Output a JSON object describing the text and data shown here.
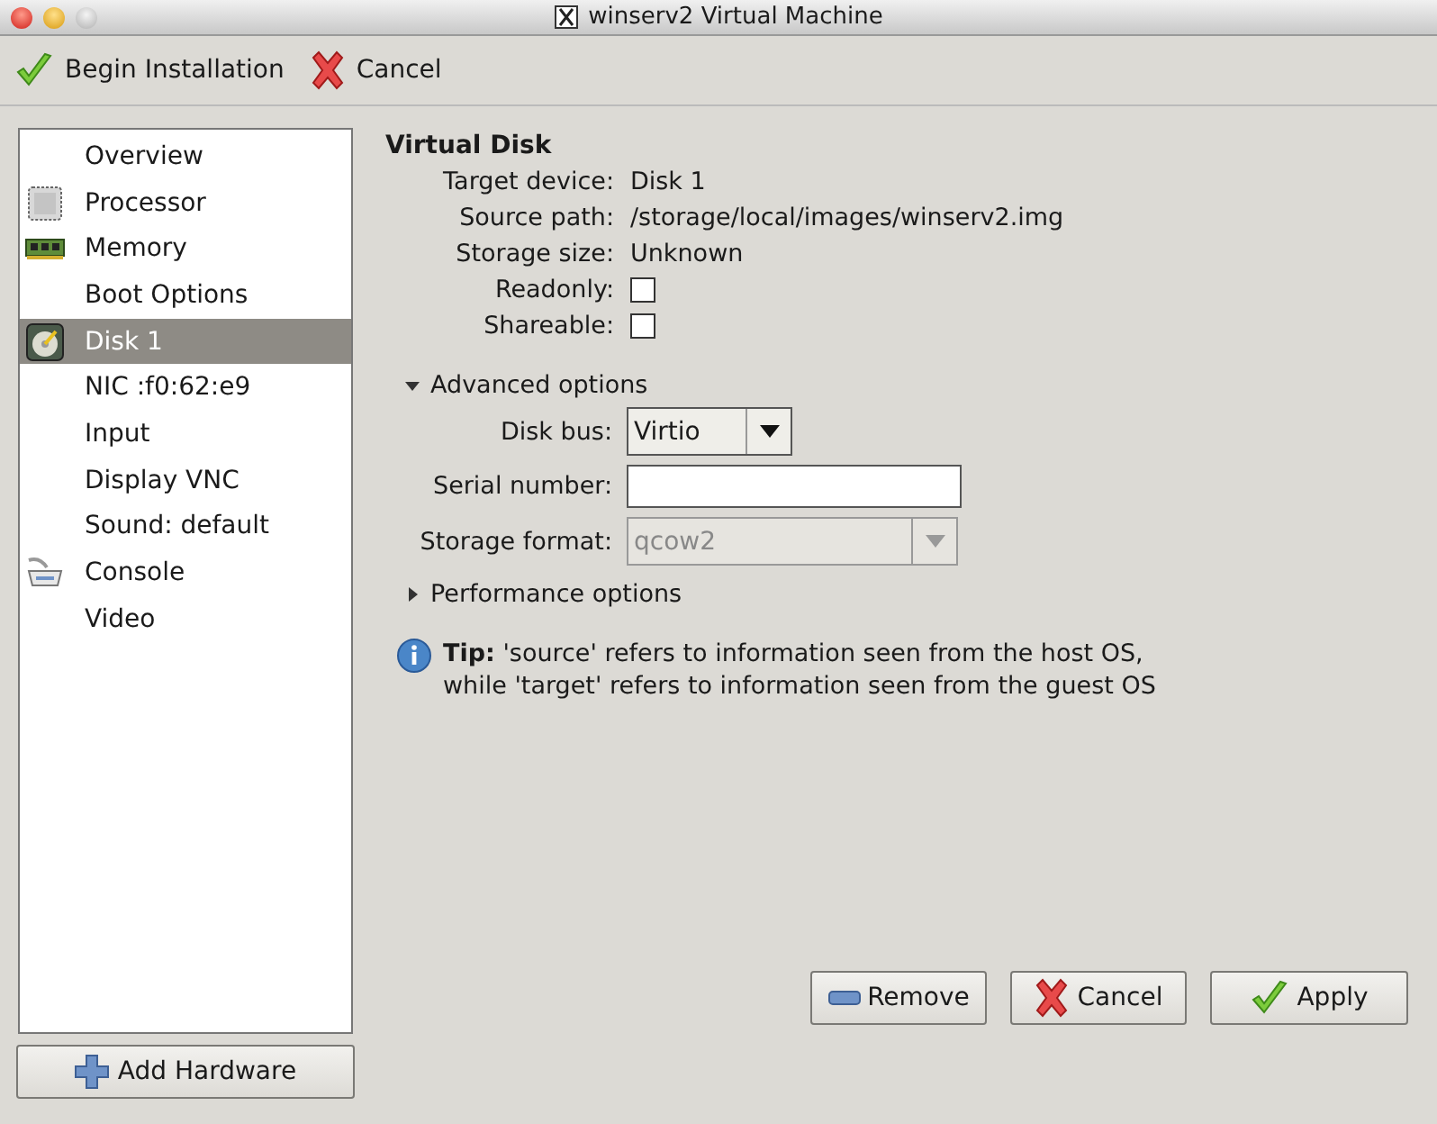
{
  "window": {
    "title": "winserv2 Virtual Machine"
  },
  "toolbar": [
    {
      "label": "Begin Installation",
      "kind": "ok"
    },
    {
      "label": "Cancel",
      "kind": "cancel"
    }
  ],
  "sidebar": {
    "items": [
      {
        "label": "Overview",
        "kind": "none",
        "selected": false
      },
      {
        "label": "Processor",
        "kind": "cpu",
        "selected": false
      },
      {
        "label": "Memory",
        "kind": "memory",
        "selected": false
      },
      {
        "label": "Boot Options",
        "kind": "none",
        "selected": false
      },
      {
        "label": "Disk 1",
        "kind": "disk",
        "selected": true
      },
      {
        "label": "NIC :f0:62:e9",
        "kind": "none",
        "selected": false
      },
      {
        "label": "Input",
        "kind": "none",
        "selected": false
      },
      {
        "label": "Display VNC",
        "kind": "none",
        "selected": false
      },
      {
        "label": "Sound: default",
        "kind": "none",
        "selected": false
      },
      {
        "label": "Console",
        "kind": "console",
        "selected": false
      },
      {
        "label": "Video",
        "kind": "none",
        "selected": false
      }
    ],
    "add_button": "Add Hardware"
  },
  "panel": {
    "title": "Virtual Disk",
    "fields": [
      {
        "label": "Target device:",
        "kind": "text",
        "value": "Disk 1"
      },
      {
        "label": "Source path:",
        "kind": "text",
        "value": "/storage/local/images/winserv2.img"
      },
      {
        "label": "Storage size:",
        "kind": "text",
        "value": "Unknown"
      },
      {
        "label": "Readonly:",
        "kind": "checkbox",
        "checked": false
      },
      {
        "label": "Shareable:",
        "kind": "checkbox",
        "checked": false
      }
    ],
    "advanced": {
      "label": "Advanced options",
      "expanded": true,
      "fields": [
        {
          "label": "Disk bus:",
          "kind": "combo",
          "value": "Virtio",
          "disabled": false
        },
        {
          "label": "Serial number:",
          "kind": "entry"
        },
        {
          "label": "Storage format:",
          "kind": "combo",
          "value": "qcow2",
          "disabled": true
        }
      ]
    },
    "performance": {
      "label": "Performance options",
      "expanded": false
    },
    "tip": "**Tip:** 'source' refers to information seen from the host OS,\nwhile 'target' refers to information seen from the guest OS"
  },
  "buttons": [
    {
      "label": "Remove",
      "kind": "remove"
    },
    {
      "label": "Cancel",
      "kind": "cancel"
    },
    {
      "label": "Apply",
      "kind": "ok"
    }
  ]
}
